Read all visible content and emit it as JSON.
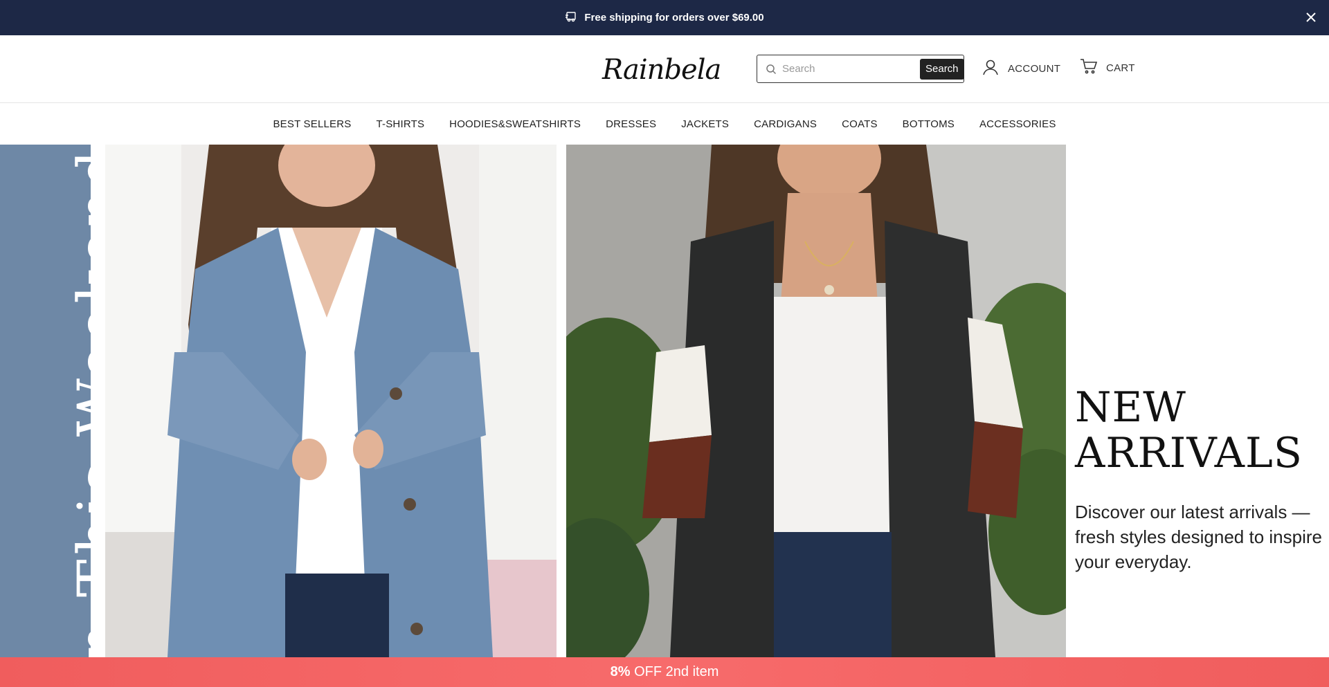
{
  "announcement": {
    "text": "Free shipping for orders over $69.00",
    "icon": "delivery-truck-icon",
    "close_icon": "close-icon"
  },
  "header": {
    "logo_text": "Rainbela",
    "search": {
      "placeholder": "Search",
      "value": "",
      "button_label": "Search"
    },
    "account_label": "ACCOUNT",
    "cart_label": "CART"
  },
  "nav": {
    "items": [
      {
        "label": "BEST SELLERS"
      },
      {
        "label": "T-SHIRTS"
      },
      {
        "label": "HOODIES&SWEATSHIRTS"
      },
      {
        "label": "DRESSES"
      },
      {
        "label": "JACKETS"
      },
      {
        "label": "CARDIGANS"
      },
      {
        "label": "COATS"
      },
      {
        "label": "BOTTOMS"
      },
      {
        "label": "ACCESSORIES"
      }
    ]
  },
  "hero": {
    "vertical_text": "n This Weekend",
    "heading_line1": "NEW",
    "heading_line2": "ARRIVALS",
    "description": "Discover our latest arrivals — fresh styles designed to inspire your everyday.",
    "stripe_color": "#6e88a6"
  },
  "promo": {
    "percent": "8%",
    "text": "OFF 2nd item",
    "color": "#f05d5d"
  },
  "colors": {
    "announcement_bg": "#1d2846",
    "button_dark": "#222222"
  }
}
